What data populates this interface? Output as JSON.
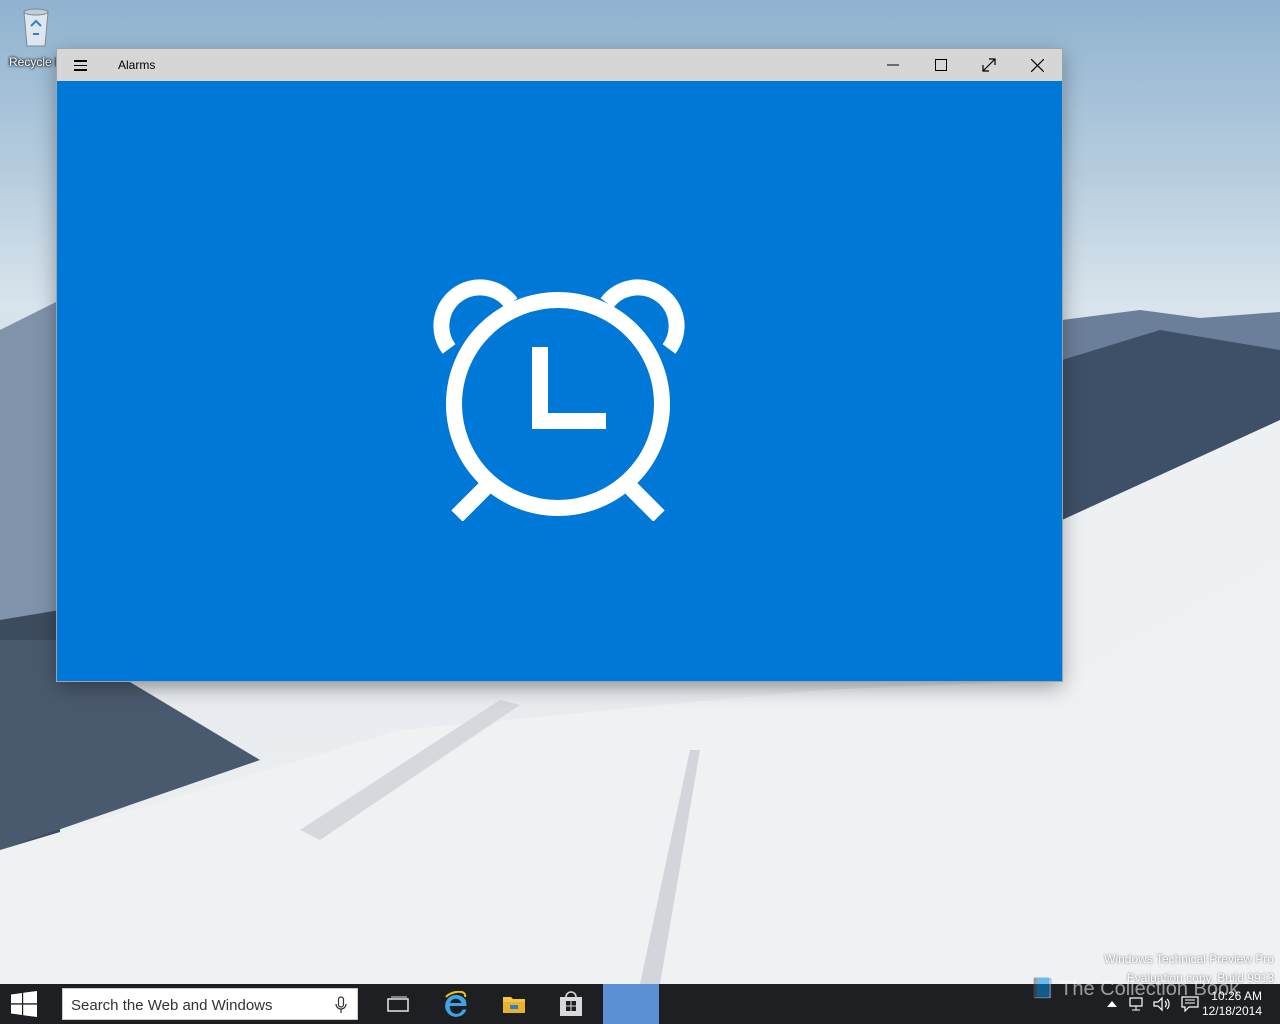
{
  "desktop": {
    "icons": [
      {
        "label": "Recycle B",
        "icon": "recycle-bin-icon"
      }
    ],
    "watermark": {
      "line1": "Windows Technical Preview Pro",
      "line2": "Evaluation copy. Build 9913"
    },
    "overlay_brand": "The Collection Book"
  },
  "window": {
    "title": "Alarms",
    "menu_icon": "hamburger-icon",
    "controls": [
      "minimize-icon",
      "maximize-icon",
      "fullscreen-icon",
      "close-icon"
    ],
    "splash_icon": "alarm-clock-icon",
    "accent_color": "#0078d7"
  },
  "taskbar": {
    "search_placeholder": "Search the Web and Windows",
    "apps": [
      "task-view-icon",
      "internet-explorer-icon",
      "file-explorer-icon",
      "store-icon",
      "alarms-app-active"
    ],
    "tray_icons": [
      "show-hidden-icons-chevron",
      "network-icon",
      "volume-icon",
      "action-center-icon"
    ],
    "time": "10:26 AM",
    "date": "12/18/2014"
  }
}
